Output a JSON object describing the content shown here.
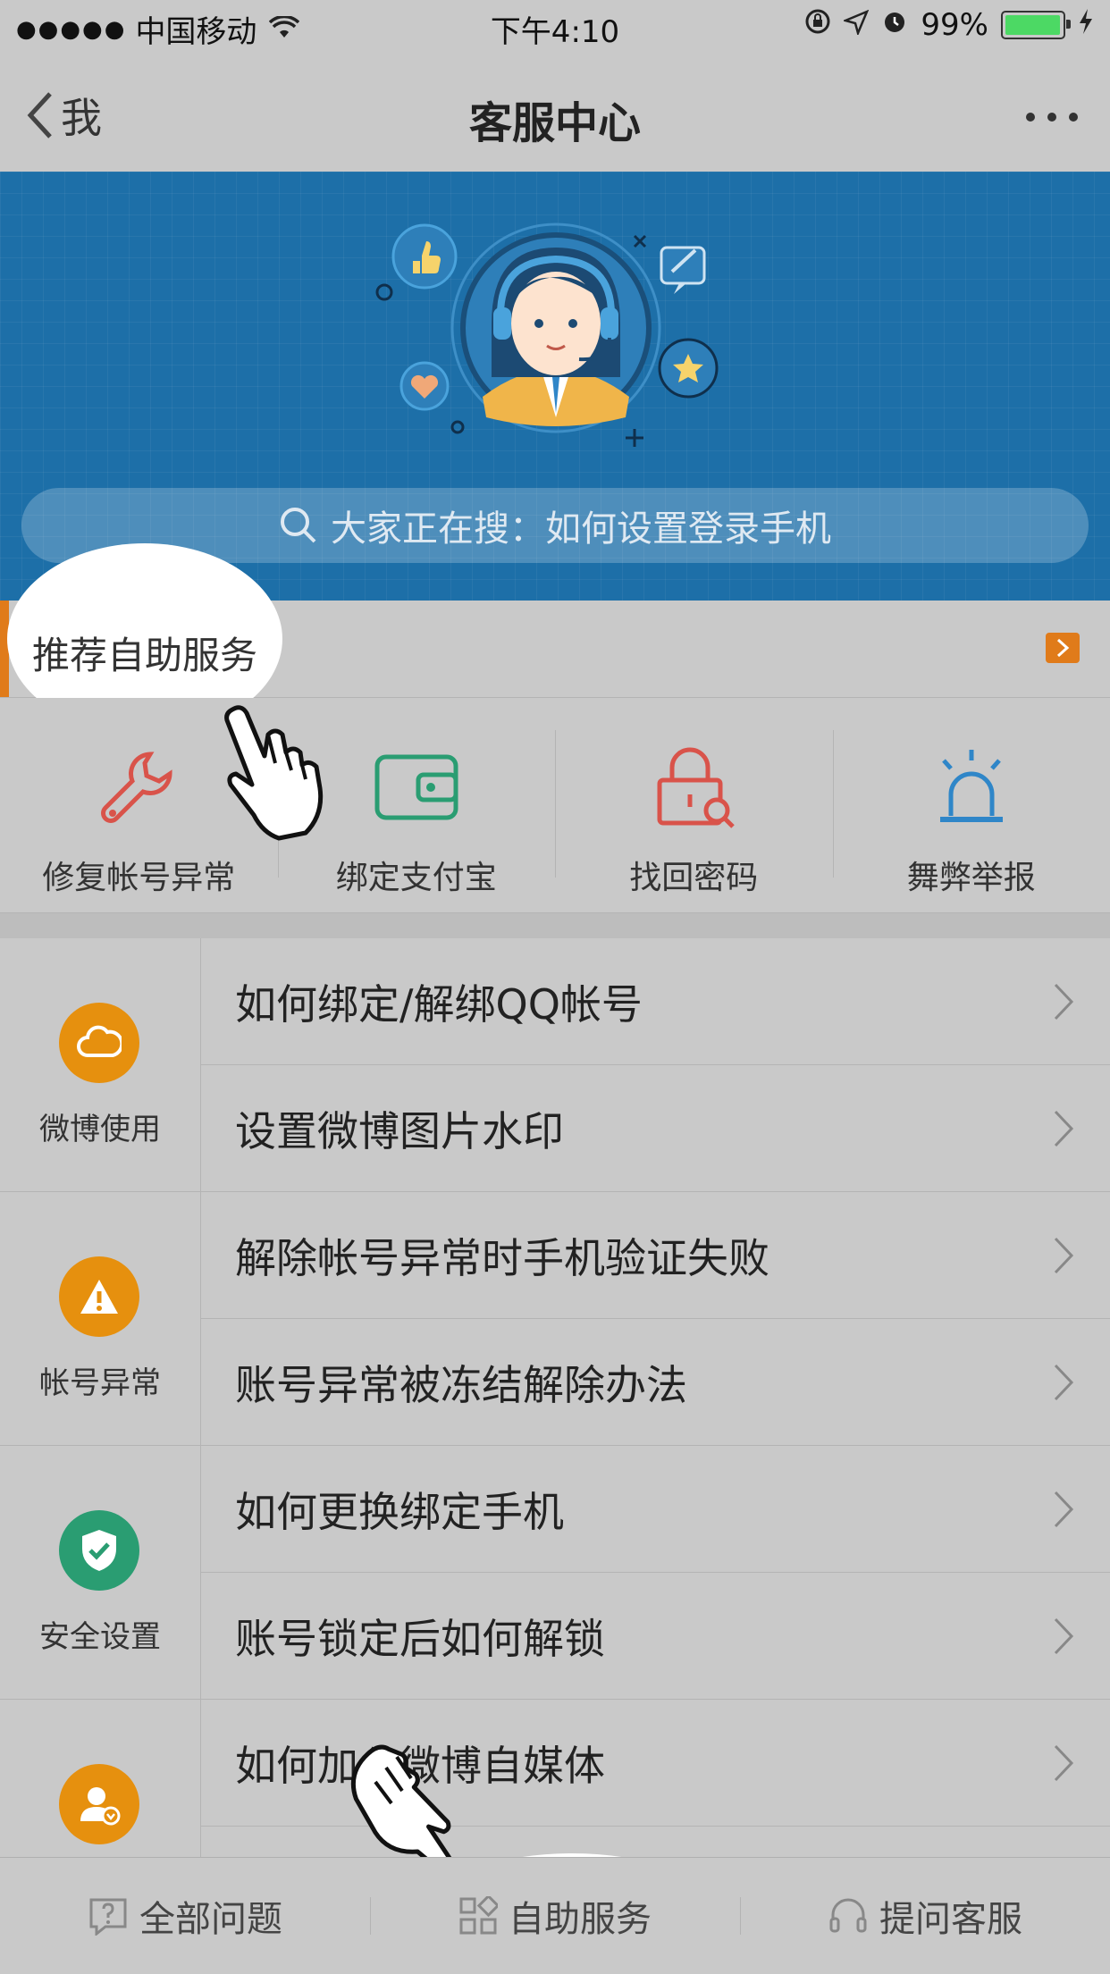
{
  "status_bar": {
    "signal": "●●●●●",
    "carrier": "中国移动",
    "time": "下午4:10",
    "battery_percent": "99%",
    "battery_level": 0.99,
    "icons": [
      "wifi-icon",
      "orientation-lock-icon",
      "location-icon",
      "alarm-icon",
      "battery-icon",
      "charging-icon"
    ]
  },
  "nav": {
    "back_label": "我",
    "title": "客服中心"
  },
  "banner": {
    "search_text": "大家正在搜：如何设置登录手机",
    "colors": {
      "background": "#1d6fa8"
    }
  },
  "recommend": {
    "title": "推荐自助服务",
    "accent": "#e07b1a"
  },
  "services": [
    {
      "label": "修复帐号异常",
      "icon": "wrench-icon",
      "color": "#d9534a"
    },
    {
      "label": "绑定支付宝",
      "icon": "wallet-icon",
      "color": "#2a9d72"
    },
    {
      "label": "找回密码",
      "icon": "lock-search-icon",
      "color": "#d9534a"
    },
    {
      "label": "舞弊举报",
      "icon": "alarm-light-icon",
      "color": "#2f86c8"
    }
  ],
  "categories": [
    {
      "name": "微博使用",
      "icon": "cloud-icon",
      "color": "#e6900e",
      "questions": [
        "如何绑定/解绑QQ帐号",
        "设置微博图片水印"
      ]
    },
    {
      "name": "帐号异常",
      "icon": "warning-icon",
      "color": "#e6900e",
      "questions": [
        "解除帐号异常时手机验证失败",
        "账号异常被冻结解除办法"
      ]
    },
    {
      "name": "安全设置",
      "icon": "shield-check-icon",
      "color": "#2a9d72",
      "questions": [
        "如何更换绑定手机",
        "账号锁定后如何解锁"
      ]
    },
    {
      "name": "",
      "icon": "verified-user-icon",
      "color": "#e6900e",
      "questions": [
        "如何加入微博自媒体"
      ]
    }
  ],
  "tabs": [
    {
      "label": "全部问题",
      "icon": "question-icon"
    },
    {
      "label": "自助服务",
      "icon": "grid-icon"
    },
    {
      "label": "提问客服",
      "icon": "headset-icon"
    }
  ]
}
